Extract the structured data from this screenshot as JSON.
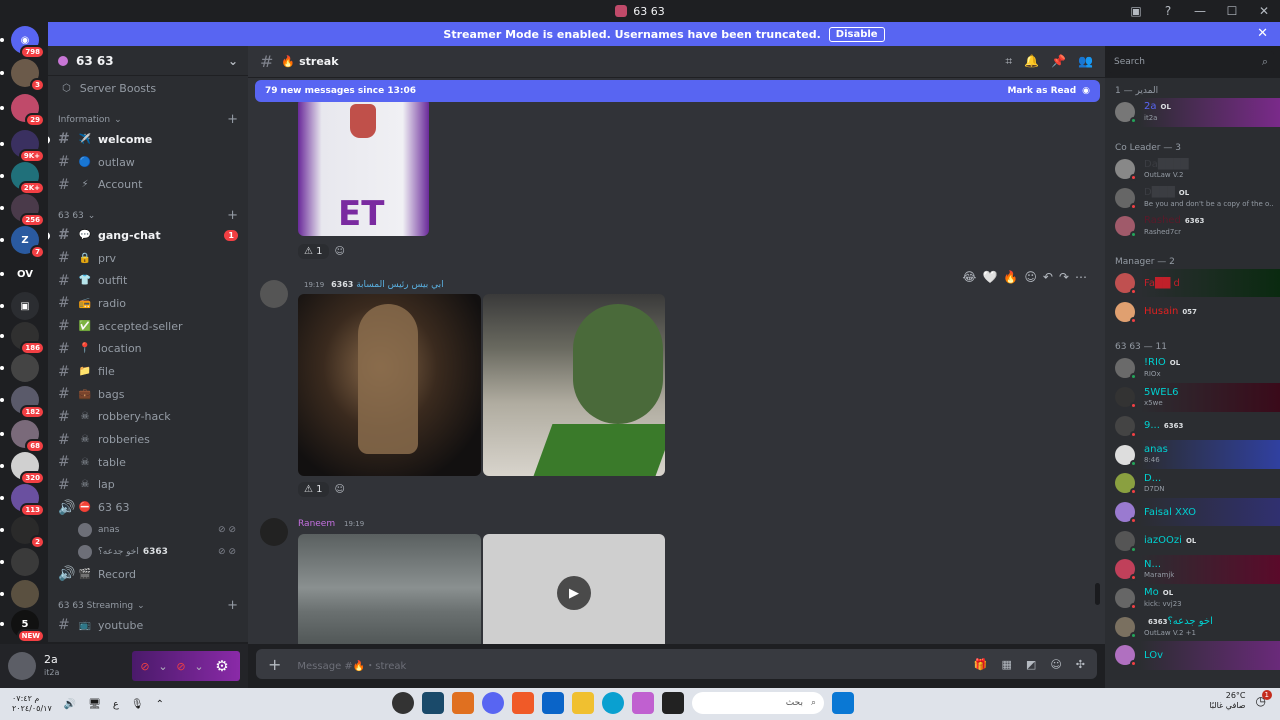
{
  "window": {
    "title": "63 63"
  },
  "banner": {
    "text": "Streamer Mode is enabled. Usernames have been truncated.",
    "action": "Disable"
  },
  "guilds": [
    {
      "badge": "798",
      "color": "#5865f2",
      "glyph": "◉"
    },
    {
      "badge": "3",
      "color": "#6b5a4a",
      "glyph": ""
    },
    {
      "badge": "29",
      "color": "#c04a6a",
      "glyph": ""
    },
    {
      "badge": "9K+",
      "color": "#3a3060",
      "glyph": ""
    },
    {
      "badge": "2K+",
      "color": "#20707a",
      "glyph": ""
    },
    {
      "badge": "256",
      "color": "#4a3a4a",
      "glyph": ""
    },
    {
      "badge": "7",
      "color": "#2a5aa0",
      "glyph": "Z"
    },
    {
      "badge": "",
      "color": "#1e1f22",
      "glyph": "OV"
    },
    {
      "badge": "",
      "color": "#2b2d31",
      "glyph": "▣"
    },
    {
      "badge": "186",
      "color": "#303030",
      "glyph": ""
    },
    {
      "badge": "",
      "color": "#444",
      "glyph": ""
    },
    {
      "badge": "182",
      "color": "#5a5a6a",
      "glyph": ""
    },
    {
      "badge": "68",
      "color": "#7a6a7a",
      "glyph": ""
    },
    {
      "badge": "320",
      "color": "#d0d0d0",
      "glyph": ""
    },
    {
      "badge": "113",
      "color": "#6a50a0",
      "glyph": ""
    },
    {
      "badge": "2",
      "color": "#2a2a2a",
      "glyph": ""
    },
    {
      "badge": "",
      "color": "#3a3a3a",
      "glyph": ""
    },
    {
      "badge": "",
      "color": "#5a5040",
      "glyph": ""
    },
    {
      "badge": "NEW",
      "color": "#111",
      "glyph": "5"
    }
  ],
  "server": {
    "name": "63 63",
    "boosts": "Server Boosts"
  },
  "categories": {
    "information": "Information",
    "main": "63 63",
    "streaming": "63 63 Streaming"
  },
  "info_channels": [
    {
      "name": "welcome",
      "emoji": "✈️",
      "bold": true
    },
    {
      "name": "outlaw",
      "emoji": "🔵",
      "bold": false
    },
    {
      "name": "Account",
      "emoji": "⚡",
      "bold": false
    }
  ],
  "main_channels": [
    {
      "name": "gang-chat",
      "emoji": "💬",
      "bold": true,
      "badge": "1"
    },
    {
      "name": "prv",
      "emoji": "🔒",
      "bold": false,
      "badge": ""
    },
    {
      "name": "outfit",
      "emoji": "👕",
      "bold": false,
      "badge": ""
    },
    {
      "name": "radio",
      "emoji": "📻",
      "bold": false,
      "badge": ""
    },
    {
      "name": "accepted-seller",
      "emoji": "✅",
      "bold": false,
      "badge": ""
    },
    {
      "name": "location",
      "emoji": "📍",
      "bold": false,
      "badge": ""
    },
    {
      "name": "file",
      "emoji": "📁",
      "bold": false,
      "badge": ""
    },
    {
      "name": "bags",
      "emoji": "💼",
      "bold": false,
      "badge": ""
    },
    {
      "name": "robbery-hack",
      "emoji": "☠",
      "bold": false,
      "badge": ""
    },
    {
      "name": "robberies",
      "emoji": "☠",
      "bold": false,
      "badge": ""
    },
    {
      "name": "table",
      "emoji": "☠",
      "bold": false,
      "badge": ""
    },
    {
      "name": "lap",
      "emoji": "☠",
      "bold": false,
      "badge": ""
    }
  ],
  "voice": {
    "name": "63 63",
    "emoji": "⛔",
    "users": [
      {
        "name": "anas",
        "tag": ""
      },
      {
        "name": "اخو جدعه؟",
        "tag": "6363"
      }
    ]
  },
  "record": {
    "name": "Record",
    "emoji": "🎬"
  },
  "streaming_channels": [
    {
      "name": "youtube",
      "emoji": "📺"
    }
  ],
  "user": {
    "name": "2a",
    "sub": "it2a"
  },
  "channel": {
    "name": "streak",
    "emoji": "🔥"
  },
  "search": {
    "placeholder": "Search"
  },
  "newbar": {
    "text": "79 new messages since 13:06",
    "action": "Mark as Read"
  },
  "messages": [
    {
      "author": "ابي بيس رئيس المسابة",
      "tag": "6363",
      "time": "19:19",
      "reaction_count": "1"
    },
    {
      "author": "Raneem",
      "tag": "",
      "time": "19:19"
    }
  ],
  "first_reaction_count": "1",
  "composer": {
    "placeholder": "Message #🔥・streak"
  },
  "member_groups": [
    {
      "title": "المدير — 1",
      "members": [
        {
          "name": "2a",
          "sub": "it2a",
          "color": "#5865f2",
          "tag": "OL",
          "bg": "#7a2a8a"
        }
      ]
    },
    {
      "title": "Co Leader — 3",
      "members": [
        {
          "name": "Da████",
          "sub": "OutLaw V.2",
          "color": "#3b3d42",
          "tag": "",
          "bg": ""
        },
        {
          "name": "D███",
          "sub": "Be you and don't be a copy of the o...",
          "color": "#3b3d42",
          "tag": "OL",
          "bg": ""
        },
        {
          "name": "Rashed",
          "sub": "Rashed7cr",
          "color": "#5a1a2a",
          "tag": "6363",
          "bg": ""
        }
      ]
    },
    {
      "title": "Manager — 2",
      "members": [
        {
          "name": "Fa██ d",
          "sub": "",
          "color": "#c0202a",
          "tag": "",
          "bg": "#0a2a10"
        },
        {
          "name": "Husain",
          "sub": "",
          "color": "#e02020",
          "tag": "057",
          "bg": ""
        }
      ]
    },
    {
      "title": "63 63 — 11",
      "members": [
        {
          "name": "!RIO",
          "sub": "RIOx",
          "color": "#00d0d0",
          "tag": "OL",
          "bg": ""
        },
        {
          "name": "5WEL6",
          "sub": "x5we",
          "color": "#00d0d0",
          "tag": "",
          "bg": "#3a0a1a"
        },
        {
          "name": "9...",
          "sub": "",
          "color": "#00d0d0",
          "tag": "6363",
          "bg": ""
        },
        {
          "name": "anas",
          "sub": "8:46",
          "color": "#00d0d0",
          "tag": "",
          "bg": "#3040a0"
        },
        {
          "name": "D...",
          "sub": "D7DN",
          "color": "#00d0d0",
          "tag": "",
          "bg": ""
        },
        {
          "name": "Faisal XXO",
          "sub": "",
          "color": "#00d0d0",
          "tag": "",
          "bg": "#303070"
        },
        {
          "name": "iazOOzi",
          "sub": "",
          "color": "#00d0d0",
          "tag": "OL",
          "bg": ""
        },
        {
          "name": "N...",
          "sub": "Maramjk",
          "color": "#00d0d0",
          "tag": "",
          "bg": "#5a0a2a"
        },
        {
          "name": "Mo",
          "sub": "kick: vvj23",
          "color": "#00d0d0",
          "tag": "OL",
          "bg": ""
        },
        {
          "name": "اخو جدعه؟",
          "sub": "OutLaw V.2 +1",
          "color": "#00d0d0",
          "tag": "6363",
          "bg": ""
        },
        {
          "name": "LOv",
          "sub": "",
          "color": "#00d0d0",
          "tag": "",
          "bg": "#6a2a7a"
        }
      ]
    }
  ],
  "taskbar": {
    "time": "م ٠٧:٤٢",
    "date": "٢٠٢٤/٠٥/١٧",
    "lang": "ع",
    "search": "بحث",
    "weather_temp": "26°C",
    "weather_desc": "صافي غالبًا",
    "notif": "1"
  }
}
